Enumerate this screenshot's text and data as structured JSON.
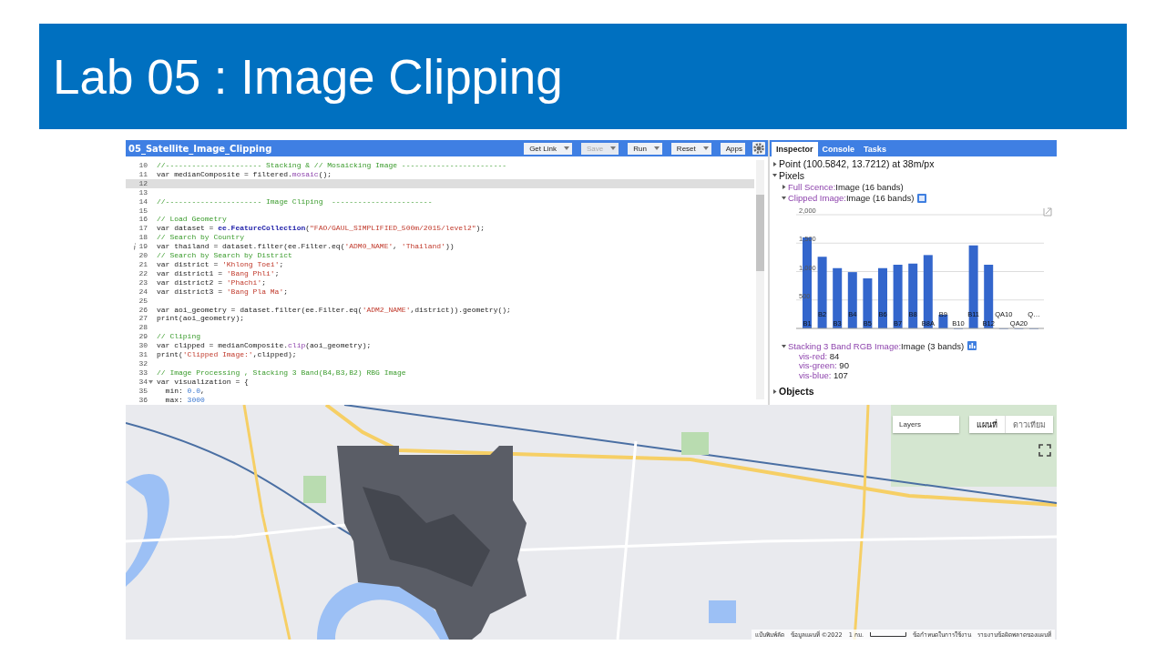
{
  "slide": {
    "title": "Lab 05 : Image Clipping"
  },
  "editor": {
    "title": "05_Satellite_Image_Clipping",
    "buttons": [
      {
        "label": "Get Link",
        "menu": true,
        "disabled": false
      },
      {
        "label": "Save",
        "menu": true,
        "disabled": true
      },
      {
        "label": "Run",
        "menu": true,
        "disabled": false
      },
      {
        "label": "Reset",
        "menu": true,
        "disabled": false
      },
      {
        "label": "Apps",
        "menu": false,
        "disabled": false
      }
    ],
    "lines": [
      {
        "number": "10",
        "current": false,
        "segments": [
          {
            "kind": "comment",
            "text": "//---------------------- Stacking & // Mosaicking Image ------------------------"
          }
        ]
      },
      {
        "number": "11",
        "current": false,
        "segments": [
          {
            "kind": "plain",
            "text": "var medianComposite = filtered."
          },
          {
            "kind": "method",
            "text": "mosaic"
          },
          {
            "kind": "plain",
            "text": "();"
          }
        ]
      },
      {
        "number": "12",
        "current": true
      },
      {
        "number": "13",
        "current": false
      },
      {
        "number": "14",
        "current": false,
        "segments": [
          {
            "kind": "comment",
            "text": "//---------------------- Image Cliping  -----------------------"
          }
        ]
      },
      {
        "number": "15",
        "current": false
      },
      {
        "number": "16",
        "current": false,
        "segments": [
          {
            "kind": "comment",
            "text": "// Load Geometry"
          }
        ]
      },
      {
        "number": "17",
        "current": false,
        "segments": [
          {
            "kind": "plain",
            "text": "var dataset = "
          },
          {
            "kind": "class",
            "text": "ee.FeatureCollection"
          },
          {
            "kind": "plain",
            "text": "("
          },
          {
            "kind": "string",
            "text": "\"FAO/GAUL_SIMPLIFIED_500m/2015/level2\""
          },
          {
            "kind": "plain",
            "text": ");"
          }
        ]
      },
      {
        "number": "18",
        "current": false,
        "segments": [
          {
            "kind": "comment",
            "text": "// Search by Country"
          }
        ]
      },
      {
        "number": "19",
        "current": false,
        "info": true,
        "segments": [
          {
            "kind": "plain",
            "text": "var thailand = dataset.filter(ee.Filter.eq("
          },
          {
            "kind": "string",
            "text": "'ADM0_NAME'"
          },
          {
            "kind": "plain",
            "text": ", "
          },
          {
            "kind": "string",
            "text": "'Thailand'"
          },
          {
            "kind": "plain",
            "text": "))"
          }
        ]
      },
      {
        "number": "20",
        "current": false,
        "segments": [
          {
            "kind": "comment",
            "text": "// Search by Search by District"
          }
        ]
      },
      {
        "number": "21",
        "current": false,
        "segments": [
          {
            "kind": "plain",
            "text": "var district = "
          },
          {
            "kind": "string",
            "text": "'Khlong Toei'"
          },
          {
            "kind": "plain",
            "text": ";"
          }
        ]
      },
      {
        "number": "22",
        "current": false,
        "segments": [
          {
            "kind": "plain",
            "text": "var district1 = "
          },
          {
            "kind": "string",
            "text": "'Bang Phli'"
          },
          {
            "kind": "plain",
            "text": ";"
          }
        ]
      },
      {
        "number": "23",
        "current": false,
        "segments": [
          {
            "kind": "plain",
            "text": "var district2 = "
          },
          {
            "kind": "string",
            "text": "'Phachi'"
          },
          {
            "kind": "plain",
            "text": ";"
          }
        ]
      },
      {
        "number": "24",
        "current": false,
        "segments": [
          {
            "kind": "plain",
            "text": "var district3 = "
          },
          {
            "kind": "string",
            "text": "'Bang Pla Ma'"
          },
          {
            "kind": "plain",
            "text": ";"
          }
        ]
      },
      {
        "number": "25",
        "current": false
      },
      {
        "number": "26",
        "current": false,
        "segments": [
          {
            "kind": "plain",
            "text": "var aoi_geometry = dataset.filter(ee.Filter.eq("
          },
          {
            "kind": "string",
            "text": "'ADM2_NAME'"
          },
          {
            "kind": "plain",
            "text": ",district)).geometry();"
          }
        ]
      },
      {
        "number": "27",
        "current": false,
        "segments": [
          {
            "kind": "plain",
            "text": "print(aoi_geometry);"
          }
        ]
      },
      {
        "number": "28",
        "current": false
      },
      {
        "number": "29",
        "current": false,
        "segments": [
          {
            "kind": "comment",
            "text": "// Cliping"
          }
        ]
      },
      {
        "number": "30",
        "current": false,
        "segments": [
          {
            "kind": "plain",
            "text": "var clipped = medianComposite."
          },
          {
            "kind": "method",
            "text": "clip"
          },
          {
            "kind": "plain",
            "text": "(aoi_geometry);"
          }
        ]
      },
      {
        "number": "31",
        "current": false,
        "segments": [
          {
            "kind": "plain",
            "text": "print("
          },
          {
            "kind": "string",
            "text": "'Clipped Image:'"
          },
          {
            "kind": "plain",
            "text": ",clipped);"
          }
        ]
      },
      {
        "number": "32",
        "current": false
      },
      {
        "number": "33",
        "current": false,
        "segments": [
          {
            "kind": "comment",
            "text": "// Image Processing , Stacking 3 Band(B4,B3,B2) RBG Image"
          }
        ]
      },
      {
        "number": "34",
        "current": false,
        "foldable": true,
        "segments": [
          {
            "kind": "plain",
            "text": "var visualization = {"
          }
        ]
      },
      {
        "number": "35",
        "current": false,
        "segments": [
          {
            "kind": "plain",
            "text": "  min: "
          },
          {
            "kind": "number",
            "text": "0.0"
          },
          {
            "kind": "plain",
            "text": ","
          }
        ]
      },
      {
        "number": "36",
        "current": false,
        "segments": [
          {
            "kind": "plain",
            "text": "  max: "
          },
          {
            "kind": "number",
            "text": "3000"
          }
        ]
      }
    ]
  },
  "panel": {
    "tabs": [
      {
        "label": "Inspector",
        "selected": true
      },
      {
        "label": "Console",
        "selected": false
      },
      {
        "label": "Tasks",
        "selected": false
      }
    ],
    "point": {
      "label": "Point (100.5842, 13.7212) at 38m/px",
      "expanded": false
    },
    "pixels": {
      "label": "Pixels",
      "expanded": true,
      "children": [
        {
          "name": "Full Scence:",
          "value": "Image (16 bands)",
          "expanded": false,
          "kind": "plain"
        },
        {
          "name": "Clipped Image:",
          "value": "Image (16 bands)",
          "expanded": true,
          "kind": "table",
          "chart_data": {
            "type": "bar",
            "categories": [
              "B1",
              "B2",
              "B3",
              "B4",
              "B5",
              "B6",
              "B7",
              "B8",
              "B8A",
              "B9",
              "B10",
              "B11",
              "B12",
              "QA10",
              "QA20",
              "Q…"
            ],
            "series": [
              {
                "color": "#3366cc",
                "values": [
                  1600,
                  1260,
                  1060,
                  990,
                  880,
                  1060,
                  1120,
                  1140,
                  1290,
                  240,
                  0,
                  1460,
                  1120,
                  0,
                  0,
                  0
                ]
              }
            ],
            "ylim": [
              0,
              2000
            ],
            "yticks": [
              {
                "value": 500,
                "label": "500"
              },
              {
                "value": 1000,
                "label": "1,000"
              },
              {
                "value": 1500,
                "label": "1,500"
              },
              {
                "value": 2000,
                "label": "2,000"
              }
            ],
            "grid": true
          }
        },
        {
          "name": "Stacking 3 Band RGB Image:",
          "value": "Image (3 bands)",
          "expanded": true,
          "kind": "chart",
          "properties": [
            {
              "name": "vis-red:",
              "value": "84"
            },
            {
              "name": "vis-green:",
              "value": "90"
            },
            {
              "name": "vis-blue:",
              "value": "107"
            }
          ]
        }
      ]
    },
    "objects": {
      "label": "Objects",
      "expanded": false
    }
  },
  "map": {
    "kind": "picture",
    "layers": {
      "label": "Layers"
    },
    "map_types": [
      {
        "label": "แผนที่",
        "selected": true
      },
      {
        "label": "ดาวเทียม",
        "selected": false
      }
    ],
    "attribution": [
      "แป้นพิมพ์ลัด",
      "ข้อมูลแผนที่ ©2022",
      "1 กม.",
      "ข้อกำหนดในการใช้งาน",
      "รายงานข้อผิดพลาดของแผนที่"
    ]
  }
}
